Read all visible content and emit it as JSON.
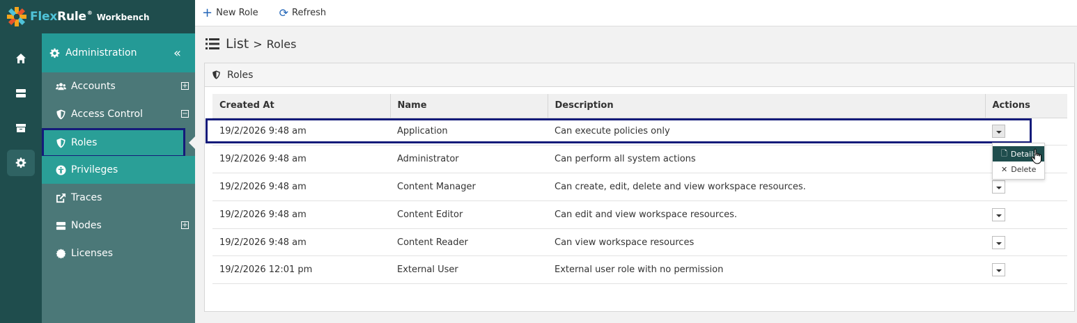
{
  "brand": {
    "name_part1": "Flex",
    "name_part2": "Rule",
    "reg": "®",
    "subtitle": "Workbench"
  },
  "toolbar": {
    "new_role": "New Role",
    "refresh": "Refresh"
  },
  "breadcrumb": {
    "list": "List",
    "separator": ">",
    "current": "Roles"
  },
  "sidebar": {
    "header": "Administration",
    "items": [
      {
        "label": "Accounts"
      },
      {
        "label": "Access Control"
      },
      {
        "label": "Roles"
      },
      {
        "label": "Privileges"
      },
      {
        "label": "Traces"
      },
      {
        "label": "Nodes"
      },
      {
        "label": "Licenses"
      }
    ]
  },
  "panel": {
    "title": "Roles"
  },
  "table": {
    "headers": [
      "Created At",
      "Name",
      "Description",
      "Actions"
    ],
    "rows": [
      {
        "created": "19/2/2026 9:48 am",
        "name": "Application",
        "description": "Can execute policies only"
      },
      {
        "created": "19/2/2026 9:48 am",
        "name": "Administrator",
        "description": "Can perform all system actions"
      },
      {
        "created": "19/2/2026 9:48 am",
        "name": "Content Manager",
        "description": "Can create, edit, delete and view workspace resources."
      },
      {
        "created": "19/2/2026 9:48 am",
        "name": "Content Editor",
        "description": "Can edit and view workspace resources."
      },
      {
        "created": "19/2/2026 9:48 am",
        "name": "Content Reader",
        "description": "Can view workspace resources"
      },
      {
        "created": "19/2/2026 12:01 pm",
        "name": "External User",
        "description": "External user role with no permission"
      }
    ]
  },
  "dropdown": {
    "details": "Details",
    "delete": "Delete"
  },
  "colors": {
    "rail": "#1f4d4d",
    "sidebar": "#4b7878",
    "accent": "#249a96",
    "highlight": "#141b7a",
    "toolbar_icon": "#2366b8"
  }
}
